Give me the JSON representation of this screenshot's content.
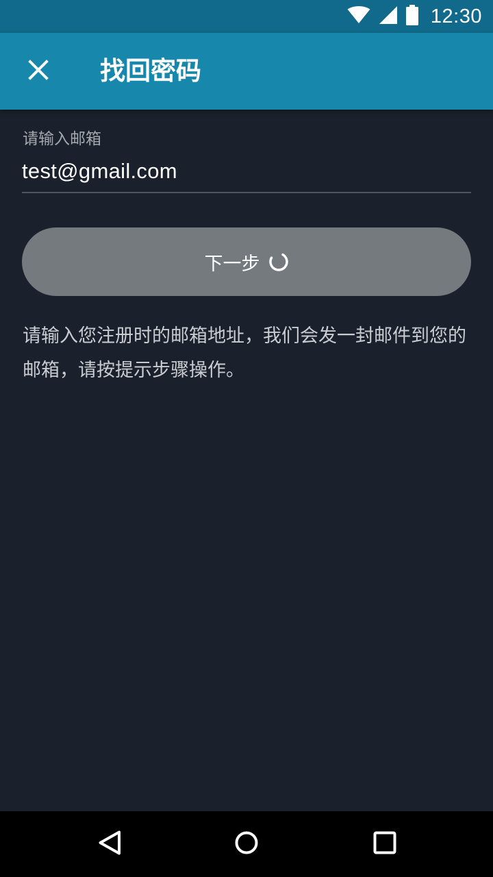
{
  "status_bar": {
    "time": "12:30",
    "icons": [
      "wifi-icon",
      "cellular-signal-icon",
      "battery-icon"
    ]
  },
  "app_bar": {
    "title": "找回密码",
    "close_icon": "close-icon"
  },
  "email_field": {
    "label": "请输入邮箱",
    "value": "test@gmail.com"
  },
  "next_button": {
    "label": "下一步",
    "state": "loading"
  },
  "hint": "请输入您注册时的邮箱地址，我们会发一封邮件到您的邮箱，请按提示步骤操作。",
  "nav_bar": {
    "icons": [
      "back-icon",
      "home-icon",
      "recents-icon"
    ]
  },
  "colors": {
    "status_bar": "#116a8b",
    "app_bar": "#1787ab",
    "background": "#1b212c",
    "button": "#757a7e",
    "nav_bar": "#000000"
  }
}
